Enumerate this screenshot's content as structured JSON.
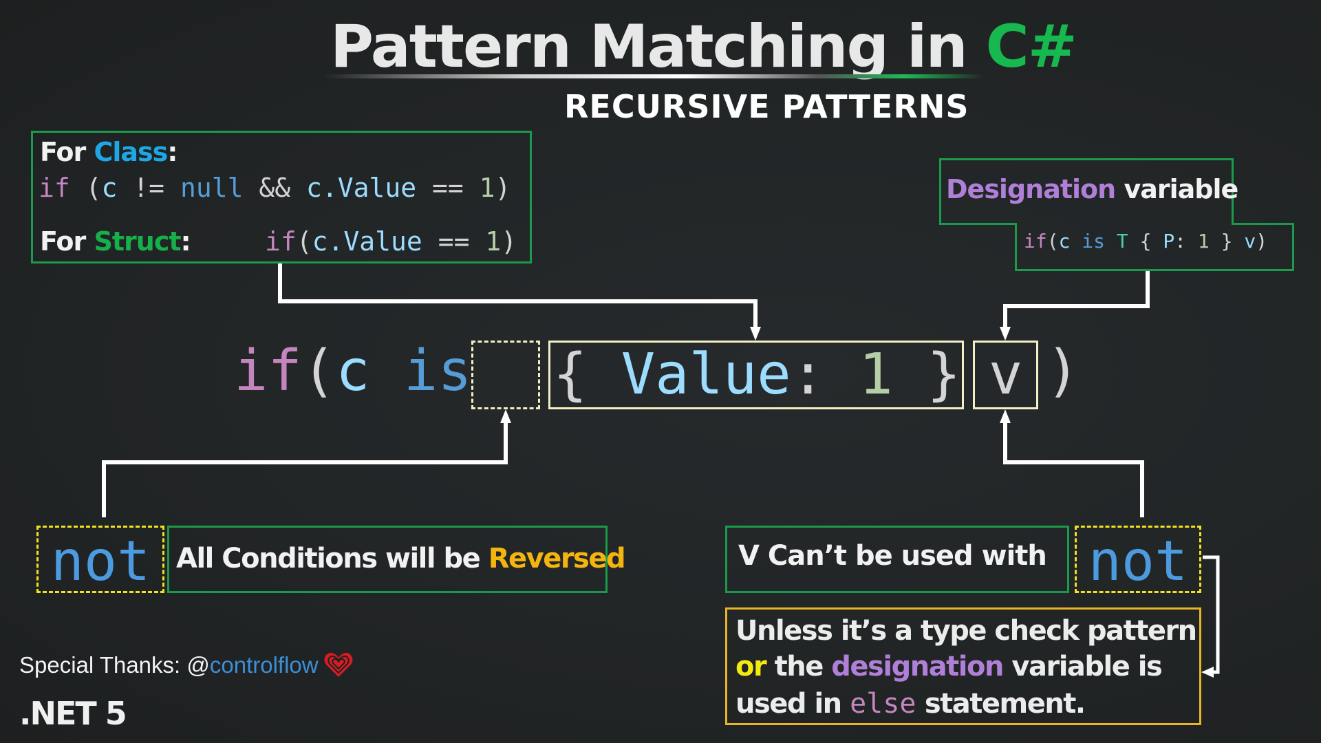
{
  "header": {
    "title_main": "Pattern Matching in ",
    "title_accent": "C#",
    "subtitle": "RECURSIVE PATTERNS"
  },
  "class_box": {
    "label_for_class": "For ",
    "label_class": "Class",
    "colon": ":",
    "class_code": [
      {
        "text": "if",
        "kind": "purple"
      },
      {
        "text": " (",
        "kind": "gray"
      },
      {
        "text": "c",
        "kind": "light"
      },
      {
        "text": " != ",
        "kind": "gray"
      },
      {
        "text": "null",
        "kind": "blue"
      },
      {
        "text": " && ",
        "kind": "gray"
      },
      {
        "text": "c.Value",
        "kind": "light"
      },
      {
        "text": " == ",
        "kind": "gray"
      },
      {
        "text": "1",
        "kind": "num"
      },
      {
        "text": ")",
        "kind": "gray"
      }
    ],
    "label_for_struct": "For ",
    "label_struct": "Struct",
    "struct_code": [
      {
        "text": "if",
        "kind": "purple"
      },
      {
        "text": "(",
        "kind": "gray"
      },
      {
        "text": "c.Value",
        "kind": "light"
      },
      {
        "text": " == ",
        "kind": "gray"
      },
      {
        "text": "1",
        "kind": "num"
      },
      {
        "text": ")",
        "kind": "gray"
      }
    ]
  },
  "designation_box": {
    "label_accent": "Designation",
    "label_rest": " variable",
    "code": [
      {
        "text": "if",
        "kind": "purple"
      },
      {
        "text": "(",
        "kind": "gray"
      },
      {
        "text": "c",
        "kind": "light"
      },
      {
        "text": " is ",
        "kind": "blue"
      },
      {
        "text": "T",
        "kind": "teal"
      },
      {
        "text": " { ",
        "kind": "gray"
      },
      {
        "text": "P",
        "kind": "light"
      },
      {
        "text": ": ",
        "kind": "gray"
      },
      {
        "text": "1",
        "kind": "num"
      },
      {
        "text": " } ",
        "kind": "gray"
      },
      {
        "text": "v",
        "kind": "light"
      },
      {
        "text": ")",
        "kind": "gray"
      }
    ]
  },
  "main_expression": {
    "if": "if",
    "open_paren": "(",
    "subject": "c",
    "is": " is",
    "brace_open": "{",
    "property": " Value",
    "colon": ":",
    "value": " 1",
    "brace_close": " }",
    "designation": "v",
    "close_paren": ")"
  },
  "not_left": {
    "keyword": "not",
    "desc_main": "All Conditions will be ",
    "desc_accent": "Reversed"
  },
  "not_right": {
    "keyword": "not",
    "vcant": "V Can’t be used with",
    "unless_line1": "Unless it’s a type check pattern",
    "unless_or": "or",
    "unless_the": " the ",
    "unless_desig": "designation",
    "unless_rest2": " variable is",
    "unless_line3a": "used in ",
    "unless_else": "else",
    "unless_line3b": " statement."
  },
  "footer": {
    "thanks_label": "Special Thanks: @",
    "thanks_handle": "controlflow",
    "heart_icon": "heart-icon",
    "version": ".NET 5"
  },
  "colors": {
    "green_border": "#1a9b4b",
    "cream_border": "#f4f0c4",
    "yellow_dash": "#f2e21f",
    "orange_border": "#e9b425",
    "csharp_green": "#16b84f",
    "keyword_purple": "#c586c0",
    "keyword_blue": "#569cd6",
    "identifier_light": "#9cdcfe",
    "number_green": "#b5cea8",
    "type_teal": "#4ec9b0"
  }
}
